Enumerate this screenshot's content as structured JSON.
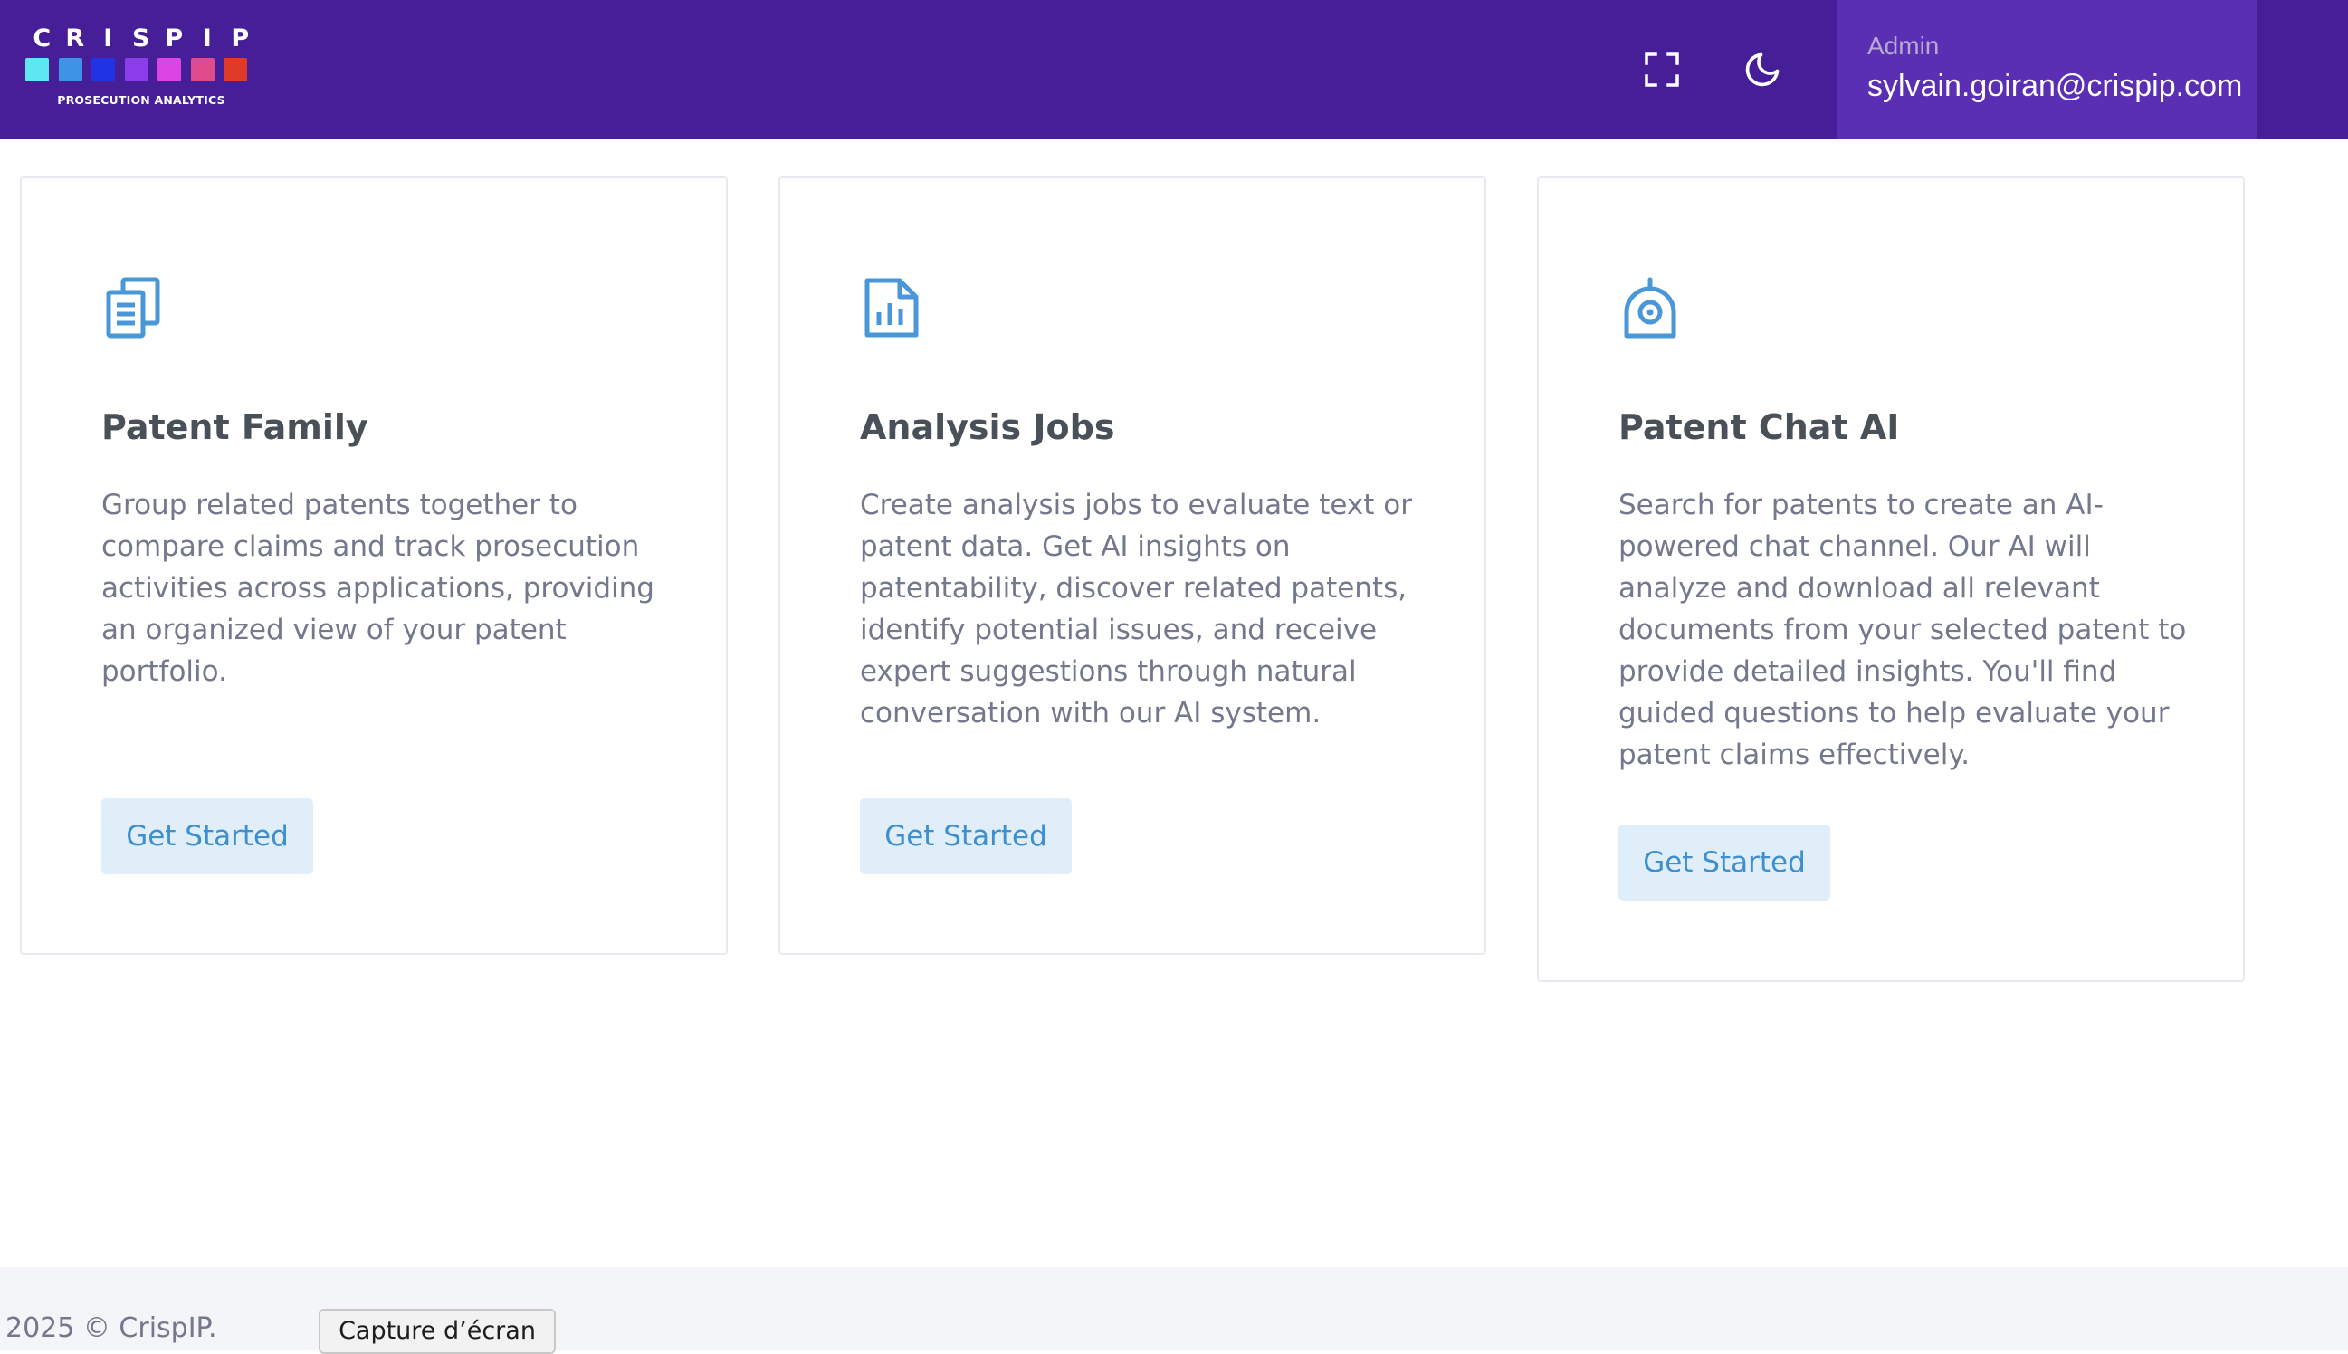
{
  "header": {
    "logo": {
      "letters": [
        "C",
        "R",
        "I",
        "S",
        "P",
        "I",
        "P"
      ],
      "squares": [
        "#5ee6f1",
        "#3d94e6",
        "#2034e6",
        "#8a3de8",
        "#dc45e4",
        "#e04b8c",
        "#e03a28"
      ],
      "subtitle": "PROSECUTION ANALYTICS"
    },
    "fullscreen_icon": "fullscreen-icon",
    "theme_icon": "moon-icon",
    "user": {
      "role": "Admin",
      "email": "sylvain.goiran@crispip.com"
    }
  },
  "cards": [
    {
      "icon": "documents-icon",
      "title": "Patent Family",
      "text": "Group related patents together to compare claims and track prosecution activities across applications, providing an organized view of your patent portfolio.",
      "button": "Get Started"
    },
    {
      "icon": "chart-file-icon",
      "title": "Analysis Jobs",
      "text": "Create analysis jobs to evaluate text or patent data. Get AI insights on patentability, discover related patents, identify potential issues, and receive expert suggestions through natural conversation with our AI system.",
      "button": "Get Started"
    },
    {
      "icon": "robot-icon",
      "title": "Patent Chat AI",
      "text": "Search for patents to create an AI-powered chat channel. Our AI will analyze and download all relevant documents from your selected patent to provide detailed insights. You'll find guided questions to help evaluate your patent claims effectively.",
      "button": "Get Started"
    }
  ],
  "footer": {
    "copyright": "2025 © CrispIP."
  },
  "tooltip": {
    "label": "Capture d’écran"
  },
  "colors": {
    "header_bg": "#461f98",
    "user_box_bg": "#5a2fb3",
    "accent": "#3d8fd0",
    "button_bg": "#e0eef9"
  }
}
